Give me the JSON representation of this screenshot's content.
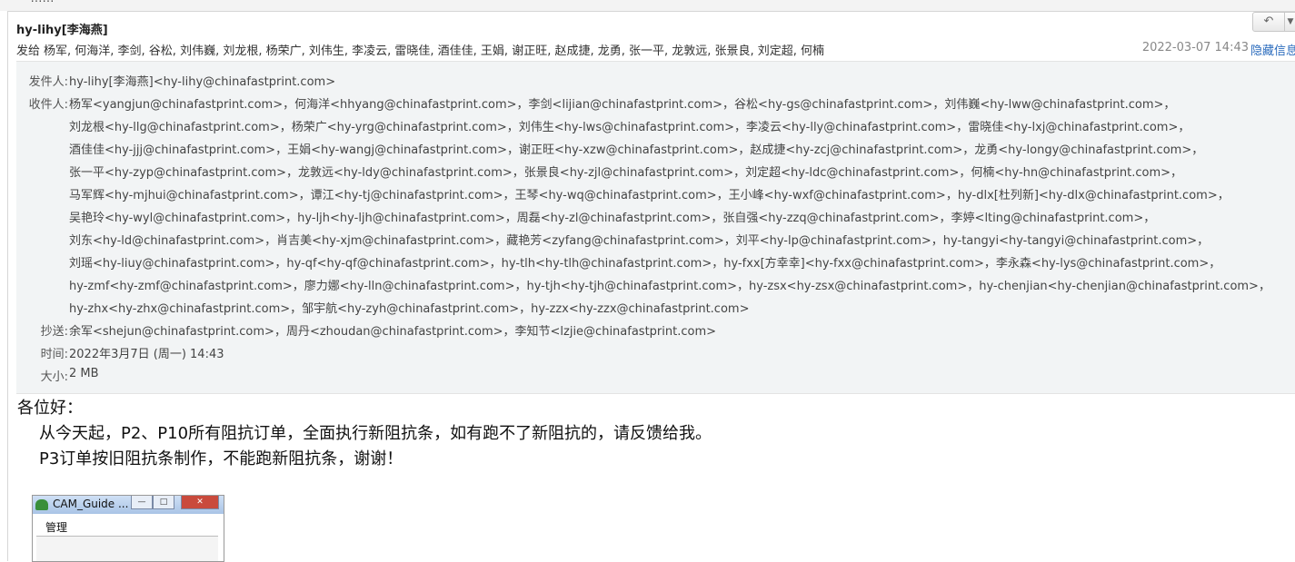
{
  "header": {
    "sender_display": "hy-lihy[李海燕]",
    "sendto_label": "发给",
    "sendto_list": "杨军, 何海洋, 李剑, 谷松, 刘伟巍, 刘龙根, 杨荣广, 刘伟生, 李凌云, 雷晓佳, 酒佳佳, 王娟, 谢正旺, 赵成捷, 龙勇, 张一平, 龙敦远, 张景良, 刘定超, 何楠",
    "datetime": "2022-03-07 14:43",
    "hide_details_label": "隐藏信息"
  },
  "details": {
    "from_label": "发件人:",
    "from": "hy-lihy[李海燕]<hy-lihy@chinafastprint.com>",
    "to_label": "收件人:",
    "to_lines": [
      "杨军<yangjun@chinafastprint.com>，何海洋<hhyang@chinafastprint.com>，李剑<lijian@chinafastprint.com>，谷松<hy-gs@chinafastprint.com>，刘伟巍<hy-lww@chinafastprint.com>，",
      "刘龙根<hy-llg@chinafastprint.com>，杨荣广<hy-yrg@chinafastprint.com>，刘伟生<hy-lws@chinafastprint.com>，李凌云<hy-lly@chinafastprint.com>，雷晓佳<hy-lxj@chinafastprint.com>，",
      "酒佳佳<hy-jjj@chinafastprint.com>，王娟<hy-wangj@chinafastprint.com>，谢正旺<hy-xzw@chinafastprint.com>，赵成捷<hy-zcj@chinafastprint.com>，龙勇<hy-longy@chinafastprint.com>，",
      "张一平<hy-zyp@chinafastprint.com>，龙敦远<hy-ldy@chinafastprint.com>，张景良<hy-zjl@chinafastprint.com>，刘定超<hy-ldc@chinafastprint.com>，何楠<hy-hn@chinafastprint.com>，",
      "马军辉<hy-mjhui@chinafastprint.com>，谭江<hy-tj@chinafastprint.com>，王琴<hy-wq@chinafastprint.com>，王小峰<hy-wxf@chinafastprint.com>，hy-dlx[杜列新]<hy-dlx@chinafastprint.com>，",
      "吴艳玲<hy-wyl@chinafastprint.com>，hy-ljh<hy-ljh@chinafastprint.com>，周磊<hy-zl@chinafastprint.com>，张自强<hy-zzq@chinafastprint.com>，李婷<lting@chinafastprint.com>，",
      "刘东<hy-ld@chinafastprint.com>，肖吉美<hy-xjm@chinafastprint.com>，藏艳芳<zyfang@chinafastprint.com>，刘平<hy-lp@chinafastprint.com>，hy-tangyi<hy-tangyi@chinafastprint.com>，",
      "刘瑶<hy-liuy@chinafastprint.com>，hy-qf<hy-qf@chinafastprint.com>，hy-tlh<hy-tlh@chinafastprint.com>，hy-fxx[方幸幸]<hy-fxx@chinafastprint.com>，李永森<hy-lys@chinafastprint.com>，",
      "hy-zmf<hy-zmf@chinafastprint.com>，廖力娜<hy-lln@chinafastprint.com>，hy-tjh<hy-tjh@chinafastprint.com>，hy-zsx<hy-zsx@chinafastprint.com>，hy-chenjian<hy-chenjian@chinafastprint.com>，",
      "hy-zhx<hy-zhx@chinafastprint.com>，邹宇航<hy-zyh@chinafastprint.com>，hy-zzx<hy-zzx@chinafastprint.com>"
    ],
    "cc_label": "抄送:",
    "cc": "余军<shejun@chinafastprint.com>，周丹<zhoudan@chinafastprint.com>，李知节<lzjie@chinafastprint.com>",
    "time_label": "时间:",
    "time": "2022年3月7日 (周一) 14:43",
    "size_label": "大小:",
    "size": "2 MB"
  },
  "body": {
    "greeting": "各位好：",
    "line1": "从今天起，P2、P10所有阻抗订单，全面执行新阻抗条，如有跑不了新阻抗的，请反馈给我。",
    "line2": "P3订单按旧阻抗条制作，不能跑新阻抗条，谢谢！"
  },
  "thumbnail": {
    "window_title": "CAM_Guide ...",
    "menu_label": "管理"
  },
  "icons": {
    "reply": "reply-arrow-icon",
    "dropdown": "chevron-down-icon",
    "app": "app-window-icon"
  }
}
